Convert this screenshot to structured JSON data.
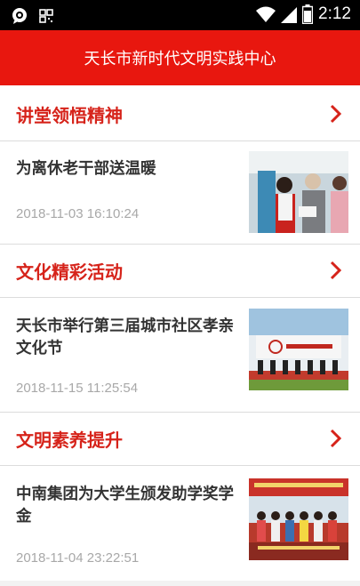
{
  "statusbar": {
    "time": "2:12",
    "left_icons": [
      "chat-bubble-icon",
      "grid-icon"
    ],
    "right_icons": [
      "wifi-icon",
      "signal-icon",
      "battery-icon"
    ]
  },
  "header": {
    "title": "天长市新时代文明实践中心",
    "bg_color": "#e8170f"
  },
  "accent_color": "#d6231a",
  "sections": [
    {
      "title": "讲堂领悟精神",
      "article": {
        "title": "为离休老干部送温暖",
        "date": "2018-11-03 16:10:24"
      }
    },
    {
      "title": "文化精彩活动",
      "article": {
        "title": "天长市举行第三届城市社区孝亲文化节",
        "date": "2018-11-15 11:25:54"
      }
    },
    {
      "title": "文明素养提升",
      "article": {
        "title": "中南集团为大学生颁发助学奖学金",
        "date": "2018-11-04 23:22:51"
      }
    }
  ]
}
